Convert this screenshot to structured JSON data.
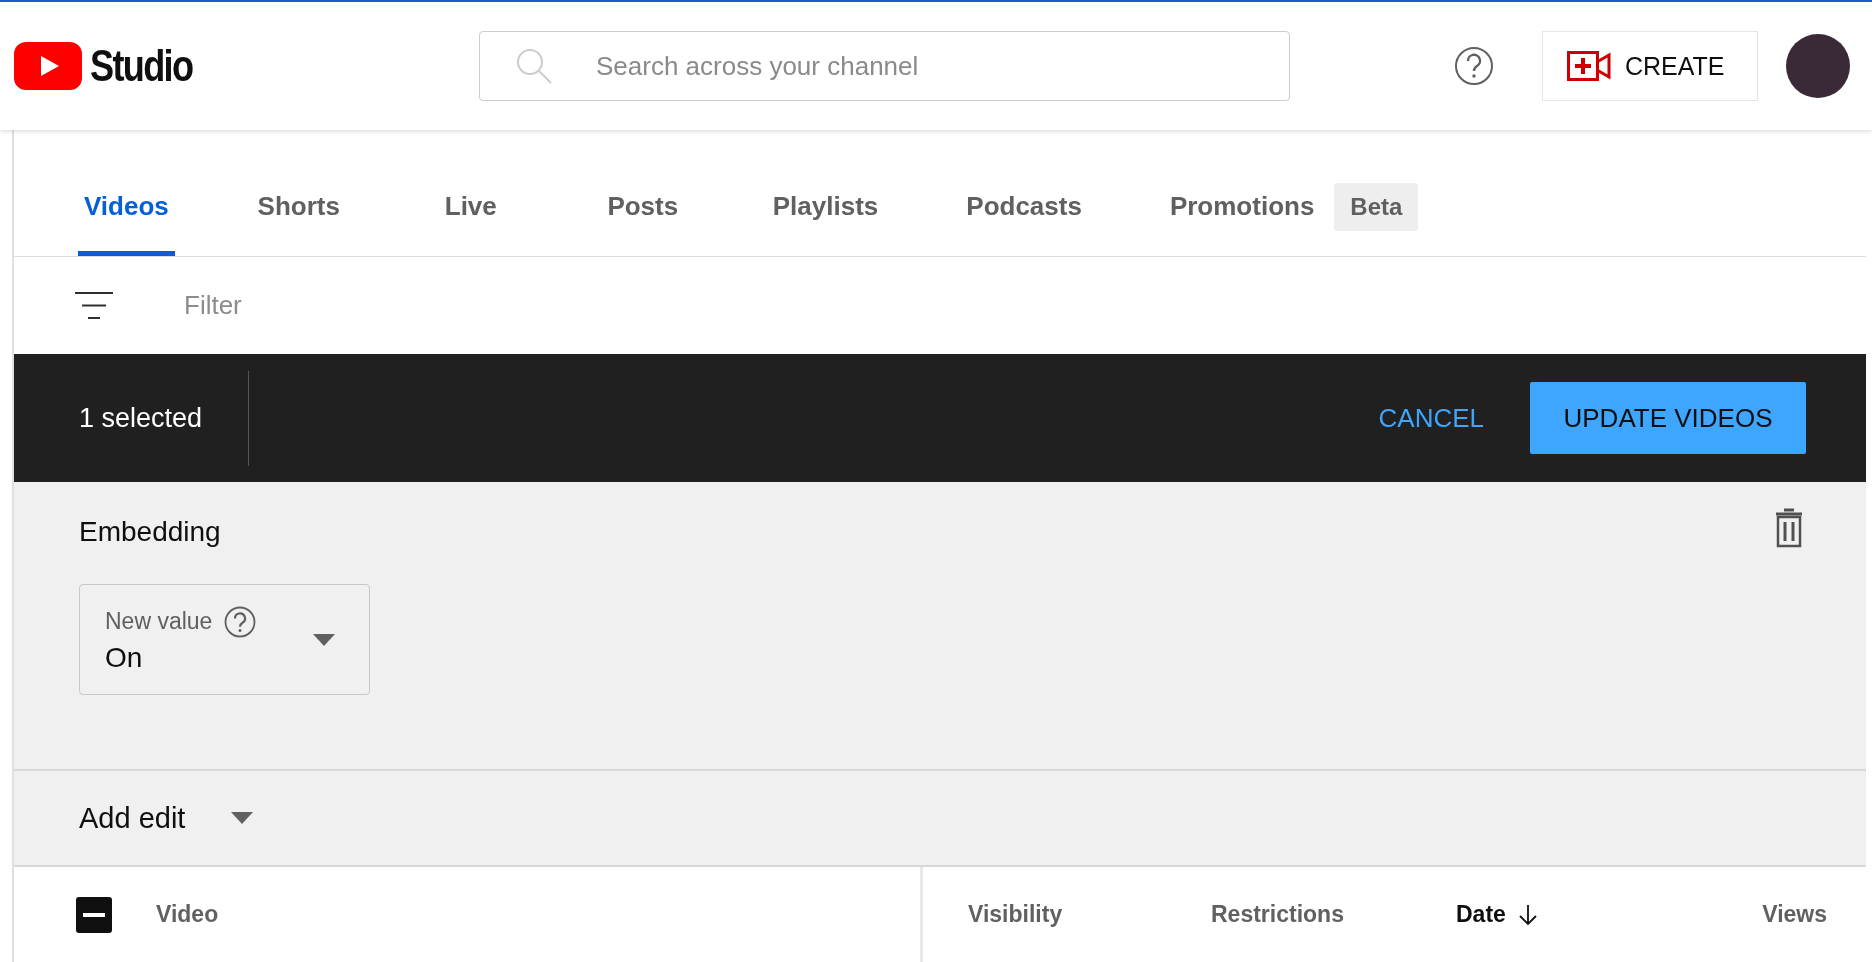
{
  "header": {
    "logo": "Studio",
    "search": {
      "placeholder": "Search across your channel"
    },
    "create_button": "CREATE"
  },
  "tabs": [
    {
      "label": "Videos",
      "selected": true
    },
    {
      "label": "Shorts",
      "selected": false
    },
    {
      "label": "Live",
      "selected": false
    },
    {
      "label": "Posts",
      "selected": false
    },
    {
      "label": "Playlists",
      "selected": false
    },
    {
      "label": "Podcasts",
      "selected": false
    },
    {
      "label": "Promotions",
      "selected": false,
      "badge": "Beta"
    }
  ],
  "filter": {
    "placeholder": "Filter"
  },
  "selection_bar": {
    "count": "1 selected",
    "cancel": "CANCEL",
    "update": "UPDATE VIDEOS"
  },
  "edit": {
    "title": "Embedding",
    "field": {
      "label": "New value",
      "value": "On"
    }
  },
  "add_edit": "Add edit",
  "table": {
    "select_all": {
      "indeterminate": true
    },
    "columns": [
      {
        "label": "Video",
        "sorted": false
      },
      {
        "label": "Visibility",
        "sorted": false
      },
      {
        "label": "Restrictions",
        "sorted": false
      },
      {
        "label": "Date",
        "sorted": true
      },
      {
        "label": "Views",
        "sorted": false
      }
    ]
  }
}
